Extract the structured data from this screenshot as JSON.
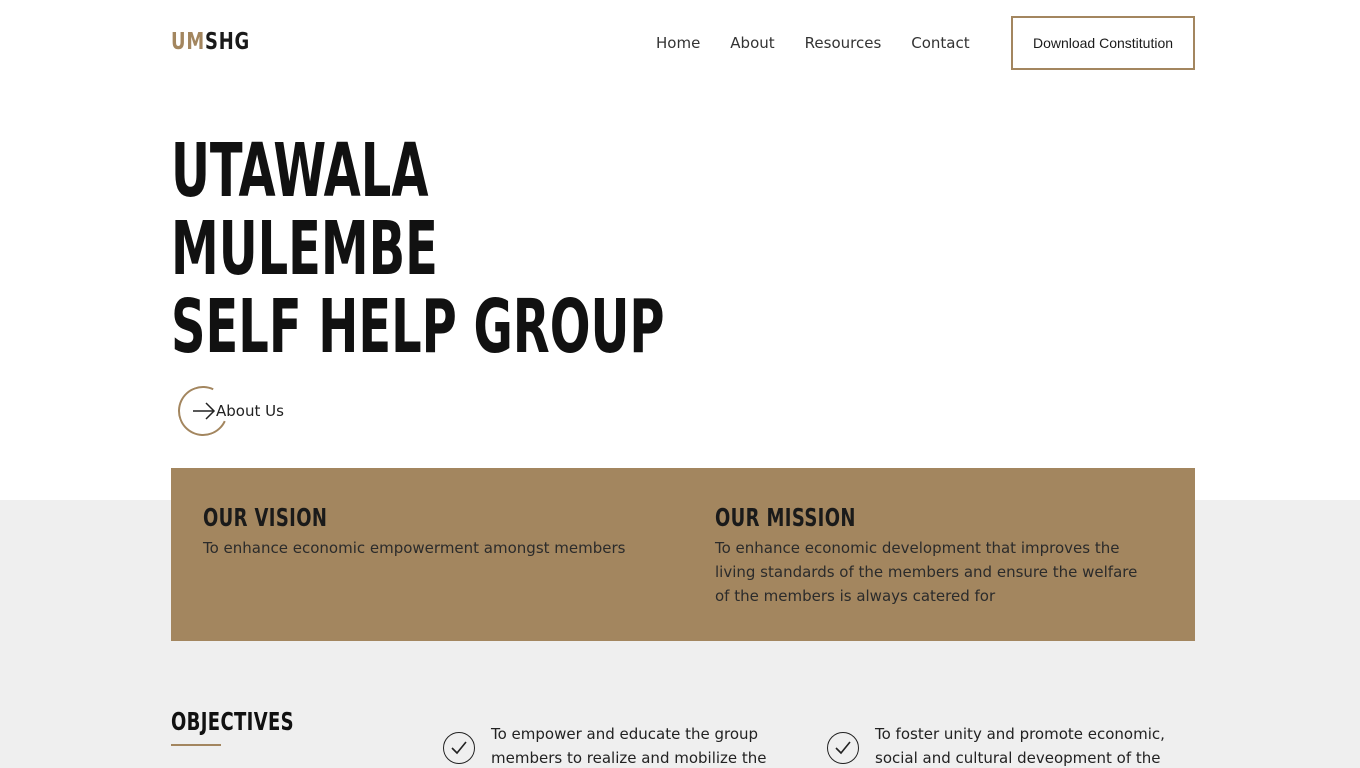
{
  "header": {
    "logo_part1": "UM",
    "logo_part2": "SHG",
    "nav": [
      "Home",
      "About",
      "Resources",
      "Contact"
    ],
    "download_label": "Download Constitution"
  },
  "hero": {
    "title_lines": [
      "UTAWALA",
      "MULEMBE",
      "SELF HELP GROUP"
    ],
    "about_link_label": "About Us"
  },
  "vision": {
    "heading": "OUR VISION",
    "text": "To enhance economic empowerment amongst members"
  },
  "mission": {
    "heading": "OUR MISSION",
    "text": "To enhance economic development that improves the living standards of the members and ensure the welfare of the members is always catered for"
  },
  "objectives": {
    "heading": "OBJECTIVES",
    "items": [
      "To empower and educate the group members to realize and mobilize the",
      "To foster unity and promote economic, social and cultural deveopment of the"
    ]
  },
  "colors": {
    "accent": "#a3865f",
    "section_bg": "#efefef",
    "text_dark": "#111111"
  },
  "icons": {
    "about_arrow": "arrow-right-icon",
    "objective_check": "check-circle-icon"
  }
}
